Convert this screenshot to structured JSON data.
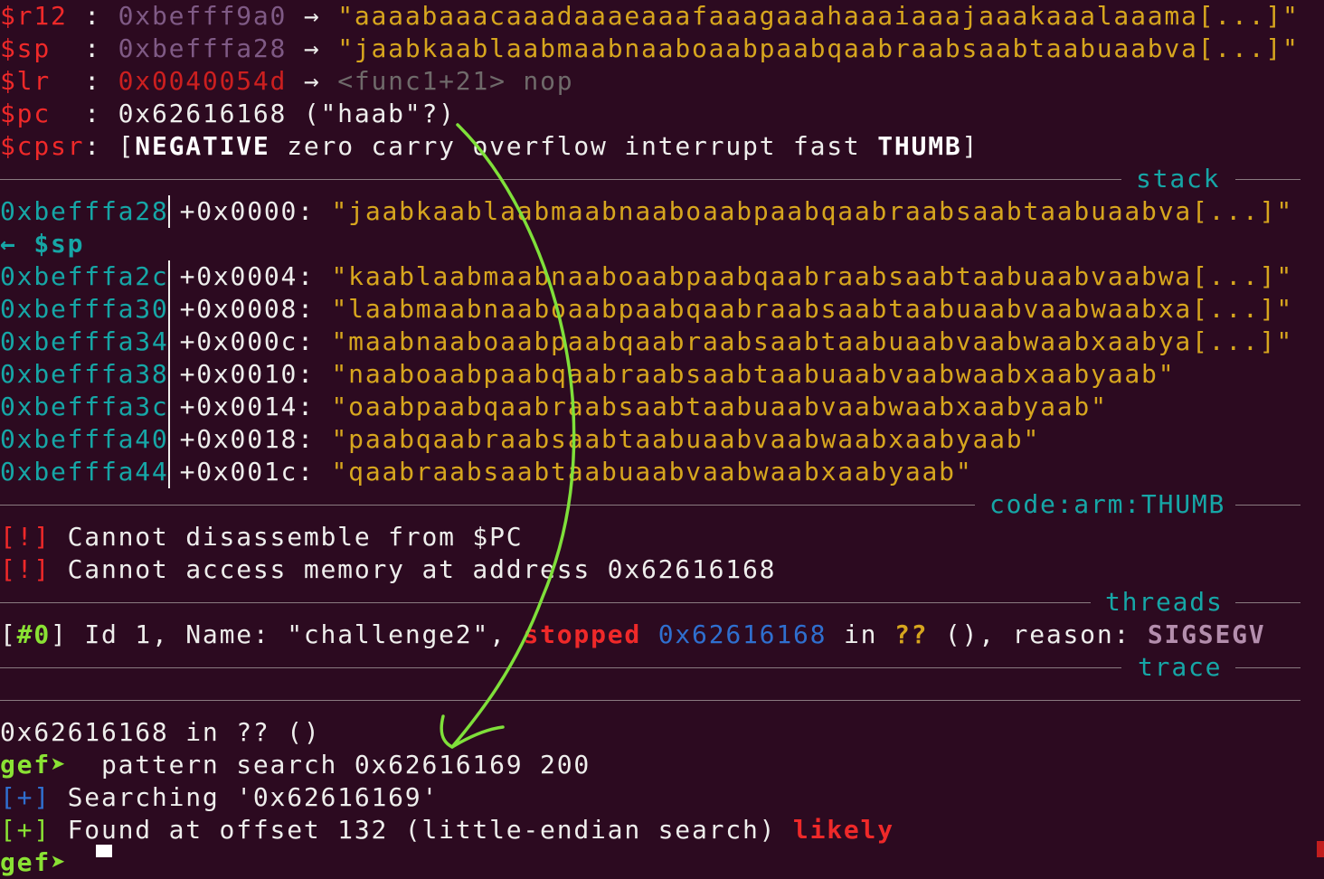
{
  "registers": [
    {
      "name": "$r12",
      "sep": " : ",
      "addr": "0xbefff9a0",
      "arrow": " → ",
      "value": "\"aaaabaaacaaadaaaeaaafaaagaaahaaaiaaajaaakaaalaaama[...]\""
    },
    {
      "name": "$sp",
      "sep": "  : ",
      "addr": "0xbefffa28",
      "arrow": " → ",
      "value": "\"jaabkaablaabmaabnaaboaabpaabqaabraabsaabtaabuaabva[...]\""
    },
    {
      "name": "$lr",
      "sep": "  : ",
      "addr": "0x0040054d",
      "arrow": " → ",
      "value": "<func1+21> nop"
    },
    {
      "name": "$pc",
      "sep": "  : ",
      "value": "0x62616168 (\"haab\"?)"
    }
  ],
  "cpsr": {
    "name": "$cpsr",
    "sep": ": ",
    "open": "[",
    "negative": "NEGATIVE",
    "flags": " zero carry overflow interrupt fast ",
    "thumb": "THUMB",
    "close": "]"
  },
  "sections": {
    "stack": "stack",
    "code": "code:arm:THUMB",
    "threads": "threads",
    "trace": "trace"
  },
  "stack": {
    "sp_marker": "← $sp",
    "rows": [
      {
        "addr": "0xbefffa28",
        "off": "+0x0000: ",
        "val": "\"jaabkaablaabmaabnaaboaabpaabqaabraabsaabtaabuaabva[...]\""
      },
      {
        "addr": "0xbefffa2c",
        "off": "+0x0004: ",
        "val": "\"kaablaabmaabnaaboaabpaabqaabraabsaabtaabuaabvaabwa[...]\""
      },
      {
        "addr": "0xbefffa30",
        "off": "+0x0008: ",
        "val": "\"laabmaabnaaboaabpaabqaabraabsaabtaabuaabvaabwaabxa[...]\""
      },
      {
        "addr": "0xbefffa34",
        "off": "+0x000c: ",
        "val": "\"maabnaaboaabpaabqaabraabsaabtaabuaabvaabwaabxaabya[...]\""
      },
      {
        "addr": "0xbefffa38",
        "off": "+0x0010: ",
        "val": "\"naaboaabpaabqaabraabsaabtaabuaabvaabwaabxaabyaab\""
      },
      {
        "addr": "0xbefffa3c",
        "off": "+0x0014: ",
        "val": "\"oaabpaabqaabraabsaabtaabuaabvaabwaabxaabyaab\""
      },
      {
        "addr": "0xbefffa40",
        "off": "+0x0018: ",
        "val": "\"paabqaabraabsaabtaabuaabvaabwaabxaabyaab\""
      },
      {
        "addr": "0xbefffa44",
        "off": "+0x001c: ",
        "val": "\"qaabraabsaabtaabuaabvaabwaabxaabyaab\""
      }
    ]
  },
  "code": {
    "tag": "[!]",
    "lines": [
      " Cannot disassemble from $PC",
      " Cannot access memory at address 0x62616168"
    ]
  },
  "thread": {
    "open": "[",
    "num": "#0",
    "close": "]",
    "pre": " Id 1, Name: \"challenge2\", ",
    "state": "stopped",
    "addr": "0x62616168",
    "in": " in ",
    "qq": "??",
    "reason": " (), reason: ",
    "signal": "SIGSEGV"
  },
  "console": {
    "trace_line": "0x62616168 in ?? ()",
    "prompt": "gef➤ ",
    "command": " pattern search 0x62616169 200",
    "plus": "[+]",
    "searching": " Searching '0x62616169'",
    "found": " Found at offset 132 (little-endian search) ",
    "likely": "likely"
  },
  "colors": {
    "background": "#2c0a20",
    "register": "#ef2929",
    "string": "#d7a61e",
    "section": "#16a6a6",
    "annotation_arrow": "#7fe03a"
  }
}
